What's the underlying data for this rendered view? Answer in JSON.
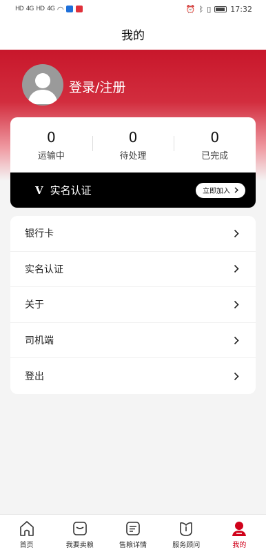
{
  "status_bar": {
    "left": [
      "HD",
      "4G",
      "HD",
      "4G"
    ],
    "time": "17:32"
  },
  "header": {
    "title": "我的"
  },
  "profile": {
    "login_label": "登录/注册"
  },
  "stats": [
    {
      "value": "0",
      "label": "运输中"
    },
    {
      "value": "0",
      "label": "待处理"
    },
    {
      "value": "0",
      "label": "已完成"
    }
  ],
  "vip": {
    "badge": "V",
    "title": "实名认证",
    "button_label": "立即加入"
  },
  "menu": [
    {
      "label": "银行卡"
    },
    {
      "label": "实名认证"
    },
    {
      "label": "关于"
    },
    {
      "label": "司机端"
    },
    {
      "label": "登出"
    }
  ],
  "tabs": [
    {
      "label": "首页",
      "icon": "home-icon"
    },
    {
      "label": "我要卖粮",
      "icon": "sell-icon"
    },
    {
      "label": "售粮详情",
      "icon": "details-icon"
    },
    {
      "label": "服务顾问",
      "icon": "advisor-icon"
    },
    {
      "label": "我的",
      "icon": "profile-icon"
    }
  ],
  "colors": {
    "accent": "#d0021b",
    "hero": "#c8172b"
  }
}
